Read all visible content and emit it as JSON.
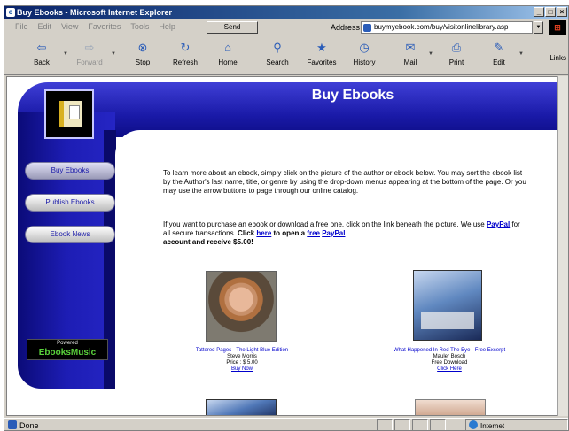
{
  "window": {
    "title": "Buy Ebooks - Microsoft Internet Explorer",
    "buttons": [
      "_",
      "□",
      "×"
    ]
  },
  "menu": [
    "File",
    "Edit",
    "View",
    "Favorites",
    "Tools",
    "Help"
  ],
  "send_label": "Send",
  "address": {
    "label": "Address",
    "url": "buymyebook.com/buy/visitonlinelibrary.asp"
  },
  "toolbar": {
    "buttons": [
      {
        "label": "Back",
        "icon": "back-arrow-icon",
        "glyph": "⇦"
      },
      {
        "label": "Forward",
        "icon": "forward-arrow-icon",
        "glyph": "⇨"
      },
      {
        "label": "Stop",
        "icon": "stop-icon",
        "glyph": "⊗"
      },
      {
        "label": "Refresh",
        "icon": "refresh-icon",
        "glyph": "↻"
      },
      {
        "label": "Home",
        "icon": "home-icon",
        "glyph": "⌂"
      },
      {
        "label": "Search",
        "icon": "search-icon",
        "glyph": "⚲"
      },
      {
        "label": "Favorites",
        "icon": "favorites-icon",
        "glyph": "★"
      },
      {
        "label": "History",
        "icon": "history-icon",
        "glyph": "◷"
      },
      {
        "label": "Mail",
        "icon": "mail-icon",
        "glyph": "✉"
      },
      {
        "label": "Print",
        "icon": "print-icon",
        "glyph": "⎙"
      },
      {
        "label": "Edit",
        "icon": "edit-icon",
        "glyph": "✎"
      }
    ],
    "links_label": "Links"
  },
  "site": {
    "title": "Buy Ebooks",
    "nav": [
      "Buy Ebooks",
      "Publish Ebooks",
      "Ebook News"
    ],
    "powered_by": "Powered",
    "powered_brand": "EbooksMusic"
  },
  "content": {
    "intro": "To learn more about an ebook, simply click on the picture of the author or ebook below. You may sort the ebook list by the Author's last name, title, or genre by using the drop-down menus appearing at the bottom of the page. Or you may use the arrow buttons to page through our online catalog.",
    "p2_a": "If you want to purchase an ebook or download a free one, click on the link beneath the picture. We use ",
    "paypal": "PayPal",
    "p2_b": " for all secure transactions. ",
    "p2_c": "Click ",
    "here": "here",
    "p2_d": " to open a ",
    "free": "free",
    "p2_e": "account and receive $5.00!",
    "books": [
      {
        "title": "Tattered Pages - The Light Blue Edition",
        "author": "Steve Morris",
        "price": "Price : $ 5.00",
        "link": "Buy Now"
      },
      {
        "title": "What Happened In Red The Eye - Free Excerpt",
        "author": "Mauler Bosch",
        "price": "Free Download",
        "link": "Click Here"
      }
    ]
  },
  "status": {
    "text": "Done",
    "zone": "Internet"
  }
}
